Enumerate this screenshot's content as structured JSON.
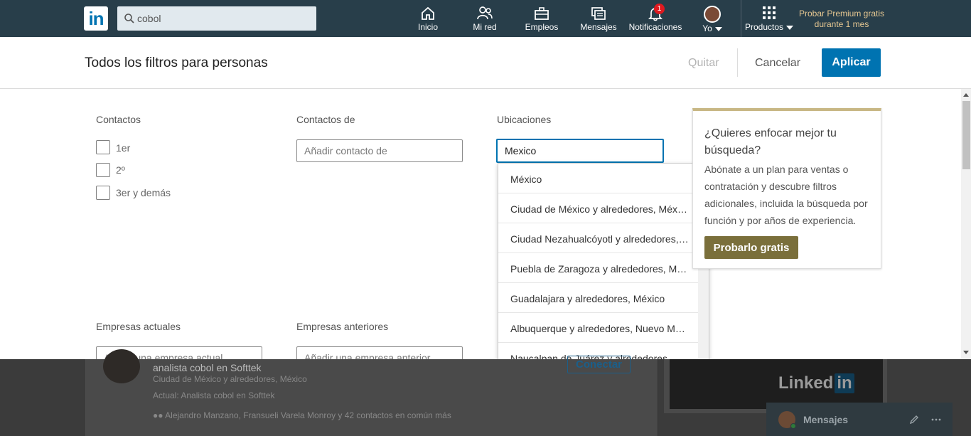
{
  "nav": {
    "search_value": "cobol",
    "items": [
      {
        "label": "Inicio"
      },
      {
        "label": "Mi red"
      },
      {
        "label": "Empleos"
      },
      {
        "label": "Mensajes"
      },
      {
        "label": "Notificaciones",
        "badge": "1"
      },
      {
        "label": "Yo"
      },
      {
        "label": "Productos"
      }
    ],
    "premium": "Probar Premium gratis durante 1 mes",
    "logo_text": "in"
  },
  "filters": {
    "title": "Todos los filtros para personas",
    "quitar": "Quitar",
    "cancelar": "Cancelar",
    "aplicar": "Aplicar",
    "contactos_label": "Contactos",
    "contactos_options": [
      "1er",
      "2º",
      "3er y demás"
    ],
    "contactos_de_label": "Contactos de",
    "contactos_de_placeholder": "Añadir contacto de",
    "ubicaciones_label": "Ubicaciones",
    "ubicaciones_value": "Mexico",
    "ubicaciones_suggestions": [
      "México",
      "Ciudad de México y alrededores, México",
      "Ciudad Nezahualcóyotl y alrededores, México",
      "Puebla de Zaragoza y alrededores, México",
      "Guadalajara y alrededores, México",
      "Albuquerque y alrededores, Nuevo México",
      "Naucalpan de Juárez y alrededores, México"
    ],
    "empresas_actuales_label": "Empresas actuales",
    "empresas_actuales_placeholder": "Añadir una empresa actual",
    "empresas_anteriores_label": "Empresas anteriores",
    "empresas_anteriores_placeholder": "Añadir una empresa anterior"
  },
  "promo": {
    "heading": "¿Quieres enfocar mejor tu búsqueda?",
    "text": "Abónate a un plan para ventas o contratación y descubre filtros adicionales, incluida la búsqueda por función y por años de experiencia.",
    "button": "Probarlo gratis"
  },
  "background": {
    "result_title": "analista cobol en Softtek",
    "result_location": "Ciudad de México y alrededores, México",
    "result_current": "Actual: Analista cobol en Softtek",
    "result_mutual": "Alejandro Manzano, Fransueli Varela Monroy y 42 contactos en común más",
    "connect_button": "Conectar",
    "ad_text": "Linked",
    "ad_in": "in",
    "messages_label": "Mensajes"
  }
}
